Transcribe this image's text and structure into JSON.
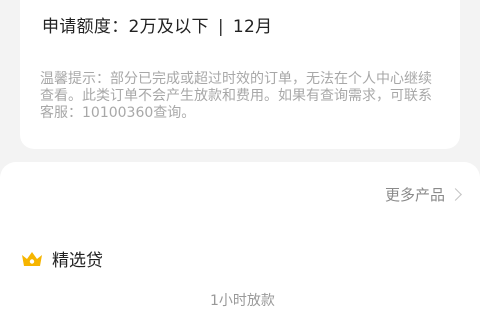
{
  "application": {
    "amount_line": "申请额度：2万及以下",
    "separator": "|",
    "term": "12月",
    "notice": "温馨提示：部分已完成或超过时效的订单，无法在个人中心继续查看。此类订单不会产生放款和费用。如果有查询需求，可联系客服：10100360查询。"
  },
  "products": {
    "more_label": "更多产品",
    "section_title": "精选贷",
    "section_icon": "crown-icon",
    "partial_hint": "1小时放款"
  },
  "colors": {
    "crown": "#f6b500",
    "notice": "#a8a8a8"
  }
}
